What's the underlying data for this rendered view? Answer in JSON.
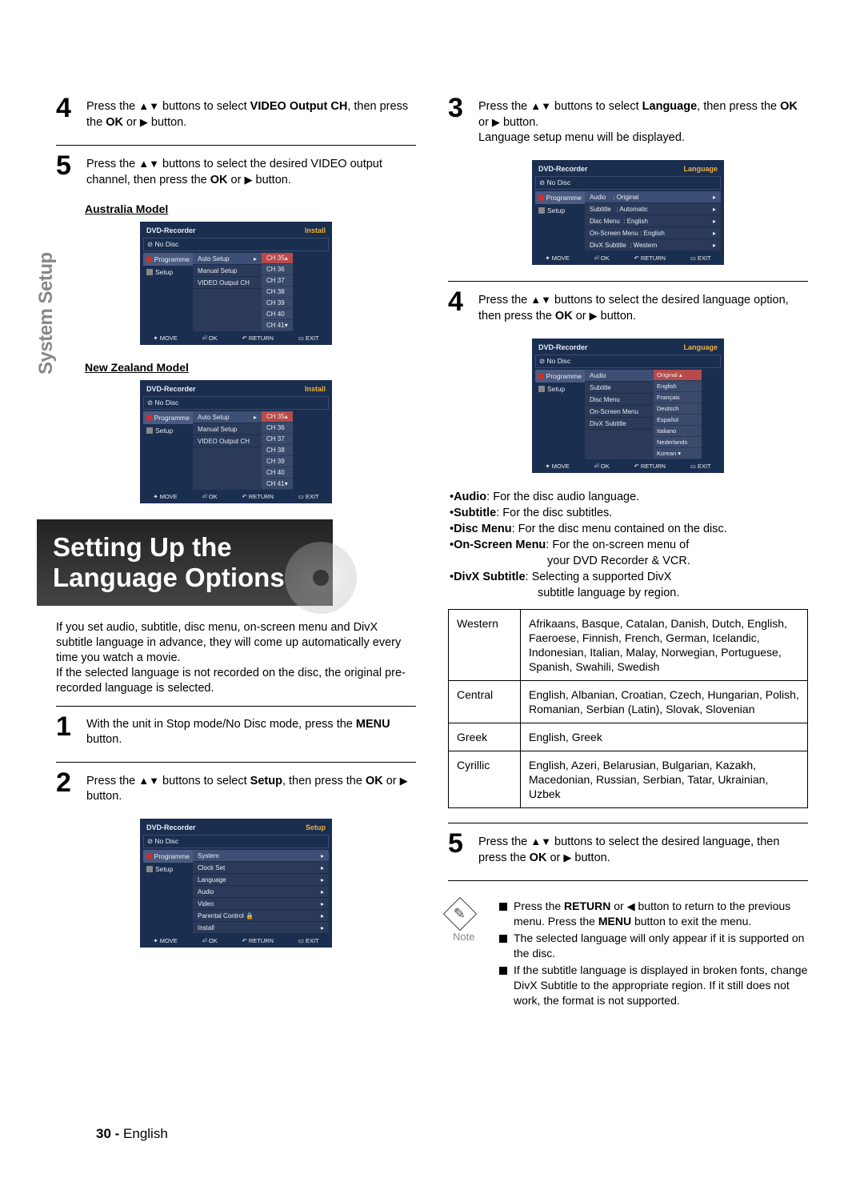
{
  "sideLabel": "System Setup",
  "pageNumber": "30 -",
  "pageLang": "English",
  "left": {
    "step4": {
      "pre": "Press the ",
      "btns": "▲▼",
      "mid1": " buttons to select ",
      "bold1": "VIDEO Output CH",
      "mid2": ", then press the ",
      "bold2": "OK",
      "mid3": " or ",
      "play": "▶",
      "end": " button."
    },
    "step5": {
      "pre": "Press the ",
      "btns": "▲▼",
      "mid1": " buttons to select the desired VIDEO output channel, then press the ",
      "bold1": "OK",
      "mid2": " or ",
      "play": "▶",
      "end": " button."
    },
    "ausLabel": "Australia Model",
    "nzLabel": "New Zealand Model",
    "osdInstall": {
      "title": "DVD-Recorder",
      "mode": "Install",
      "nodisc": "No Disc",
      "side": [
        "Programme",
        "Setup"
      ],
      "menu": [
        "Auto Setup",
        "Manual Setup",
        "VIDEO Output CH"
      ],
      "channels": [
        "CH 35",
        "CH 36",
        "CH 37",
        "CH 38",
        "CH 39",
        "CH 40",
        "CH 41"
      ],
      "foot": [
        "MOVE",
        "OK",
        "RETURN",
        "EXIT"
      ]
    },
    "sectionTitle1": "Setting Up the",
    "sectionTitle2": "Language Options",
    "intro": "If you set audio, subtitle, disc menu, on-screen menu and DivX subtitle language in advance, they will come up automatically every time you watch a movie.\nIf the selected language is not recorded on the disc, the original pre-recorded language is selected.",
    "lstep1": {
      "pre": "With the unit in Stop mode/No Disc mode, press the ",
      "bold": "MENU",
      "end": " button."
    },
    "lstep2": {
      "pre": "Press the ",
      "btns": "▲▼",
      "mid1": " buttons to select ",
      "bold1": "Setup",
      "mid2": ", then press the ",
      "bold2": "OK",
      "mid3": " or ",
      "play": "▶",
      "end": " button."
    },
    "osdSetup": {
      "title": "DVD-Recorder",
      "mode": "Setup",
      "nodisc": "No Disc",
      "side": [
        "Programme",
        "Setup"
      ],
      "menu": [
        "System",
        "Clock Set",
        "Language",
        "Audio",
        "Video",
        "Parental Control",
        "Install"
      ],
      "foot": [
        "MOVE",
        "OK",
        "RETURN",
        "EXIT"
      ]
    }
  },
  "right": {
    "step3": {
      "pre": "Press the ",
      "btns": "▲▼",
      "mid1": " buttons to select ",
      "bold1": "Language",
      "mid2": ", then press the ",
      "bold2": "OK",
      "mid3": " or ",
      "play": "▶",
      "end": " button.",
      "after": "Language setup menu will be displayed."
    },
    "osdLang1": {
      "title": "DVD-Recorder",
      "mode": "Language",
      "nodisc": "No Disc",
      "side": [
        "Programme",
        "Setup"
      ],
      "rows": [
        {
          "label": "Audio",
          "val": ": Original"
        },
        {
          "label": "Subtitle",
          "val": ": Automatic"
        },
        {
          "label": "Disc Menu",
          "val": ": English"
        },
        {
          "label": "On-Screen Menu",
          "val": ": English"
        },
        {
          "label": "DivX Subtitle",
          "val": ": Western"
        }
      ],
      "foot": [
        "MOVE",
        "OK",
        "RETURN",
        "EXIT"
      ]
    },
    "step4": {
      "pre": "Press the ",
      "btns": "▲▼",
      "mid1": " buttons to select the desired language option, then press the ",
      "bold1": "OK",
      "mid2": " or ",
      "play": "▶",
      "end": " button."
    },
    "osdLang2": {
      "title": "DVD-Recorder",
      "mode": "Language",
      "nodisc": "No Disc",
      "side": [
        "Programme",
        "Setup"
      ],
      "menu": [
        "Audio",
        "Subtitle",
        "Disc Menu",
        "On-Screen Menu",
        "DivX Subtitle"
      ],
      "langs": [
        "Original",
        "English",
        "Français",
        "Deutsch",
        "Español",
        "Italiano",
        "Nederlands",
        "Korean"
      ],
      "foot": [
        "MOVE",
        "OK",
        "RETURN",
        "EXIT"
      ]
    },
    "defs": {
      "audio": {
        "term": "Audio",
        "desc": " : For the disc audio language."
      },
      "subtitle": {
        "term": "Subtitle",
        "desc": " : For the disc subtitles."
      },
      "discmenu": {
        "term": "Disc Menu",
        "desc": " : For the disc menu contained on the disc."
      },
      "osmenu": {
        "term": "On-Screen Menu",
        "desc": " : For the on-screen menu of",
        "desc2": "your DVD Recorder & VCR."
      },
      "divx": {
        "term": "DivX Subtitle",
        "desc": " : Selecting a supported DivX",
        "desc2": "subtitle language by region."
      }
    },
    "regions": [
      {
        "name": "Western",
        "langs": "Afrikaans, Basque, Catalan, Danish, Dutch, English, Faeroese, Finnish, French, German, Icelandic, Indonesian, Italian, Malay, Norwegian, Portuguese, Spanish, Swahili, Swedish"
      },
      {
        "name": "Central",
        "langs": "English, Albanian, Croatian, Czech, Hungarian, Polish, Romanian, Serbian (Latin), Slovak, Slovenian"
      },
      {
        "name": "Greek",
        "langs": "English, Greek"
      },
      {
        "name": "Cyrillic",
        "langs": "English, Azeri, Belarusian, Bulgarian, Kazakh, Macedonian, Russian, Serbian, Tatar, Ukrainian, Uzbek"
      }
    ],
    "step5": {
      "pre": "Press the ",
      "btns": "▲▼",
      "mid1": " buttons to select the desired language, then press the ",
      "bold1": "OK",
      "mid2": " or ",
      "play": "▶",
      "end": " button."
    },
    "note": {
      "label": "Note",
      "n1a": "Press the ",
      "n1b": "RETURN",
      "n1c": " or ",
      "n1d": "◀",
      "n1e": " button to return to the previous menu. Press the ",
      "n1f": "MENU",
      "n1g": " button to exit the menu.",
      "n2": "The selected language will only appear if it is supported on the disc.",
      "n3": "If the subtitle language is displayed in broken fonts, change DivX Subtitle to the appropriate region. If it still does not work, the format is not supported."
    }
  }
}
